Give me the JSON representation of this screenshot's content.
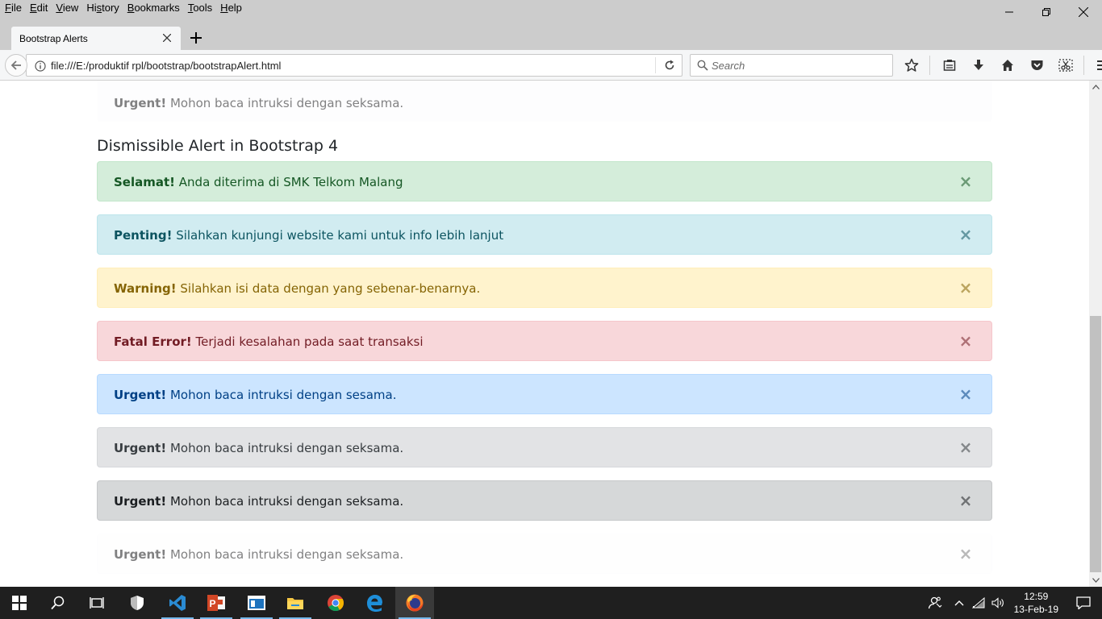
{
  "menu": {
    "items": [
      {
        "pre": "",
        "u": "F",
        "post": "ile"
      },
      {
        "pre": "",
        "u": "E",
        "post": "dit"
      },
      {
        "pre": "",
        "u": "V",
        "post": "iew"
      },
      {
        "pre": "Hi",
        "u": "s",
        "post": "tory"
      },
      {
        "pre": "",
        "u": "B",
        "post": "ookmarks"
      },
      {
        "pre": "",
        "u": "T",
        "post": "ools"
      },
      {
        "pre": "",
        "u": "H",
        "post": "elp"
      }
    ]
  },
  "tab": {
    "title": "Bootstrap Alerts"
  },
  "navbar": {
    "url": "file:///E:/produktif rpl/bootstrap/bootstrapAlert.html",
    "search_placeholder": "Search"
  },
  "page": {
    "top_alert": {
      "strong": "Urgent!",
      "text": " Mohon baca intruksi dengan seksama."
    },
    "section_title": "Dismissible Alert in Bootstrap 4",
    "close_glyph": "×",
    "alerts": [
      {
        "variant": "success",
        "strong": "Selamat!",
        "text": " Anda diterima di SMK Telkom Malang",
        "bg": "#d4edda",
        "border": "#c3e6cb",
        "color": "#155724"
      },
      {
        "variant": "info",
        "strong": "Penting!",
        "text": " Silahkan kunjungi website kami untuk info lebih lanjut",
        "bg": "#d1ecf1",
        "border": "#bee5eb",
        "color": "#0c5460"
      },
      {
        "variant": "warning",
        "strong": "Warning!",
        "text": " Silahkan isi data dengan yang sebenar-benarnya.",
        "bg": "#fff3cd",
        "border": "#ffeeba",
        "color": "#856404"
      },
      {
        "variant": "danger",
        "strong": "Fatal Error!",
        "text": " Terjadi kesalahan pada saat transaksi",
        "bg": "#f8d7da",
        "border": "#f5c6cb",
        "color": "#721c24"
      },
      {
        "variant": "primary",
        "strong": "Urgent!",
        "text": " Mohon baca intruksi dengan sesama.",
        "bg": "#cce5ff",
        "border": "#b8daff",
        "color": "#004085"
      },
      {
        "variant": "secondary",
        "strong": "Urgent!",
        "text": " Mohon baca intruksi dengan seksama.",
        "bg": "#e2e3e5",
        "border": "#d6d8db",
        "color": "#383d41"
      },
      {
        "variant": "dark",
        "strong": "Urgent!",
        "text": " Mohon baca intruksi dengan seksama.",
        "bg": "#d6d8d9",
        "border": "#c6c8ca",
        "color": "#1b1e21"
      },
      {
        "variant": "light",
        "strong": "Urgent!",
        "text": " Mohon baca intruksi dengan seksama.",
        "bg": "#fefefe",
        "border": "#fdfdfe",
        "color": "#818182"
      }
    ]
  },
  "taskbar": {
    "time": "12:59",
    "date": "13-Feb-19"
  }
}
